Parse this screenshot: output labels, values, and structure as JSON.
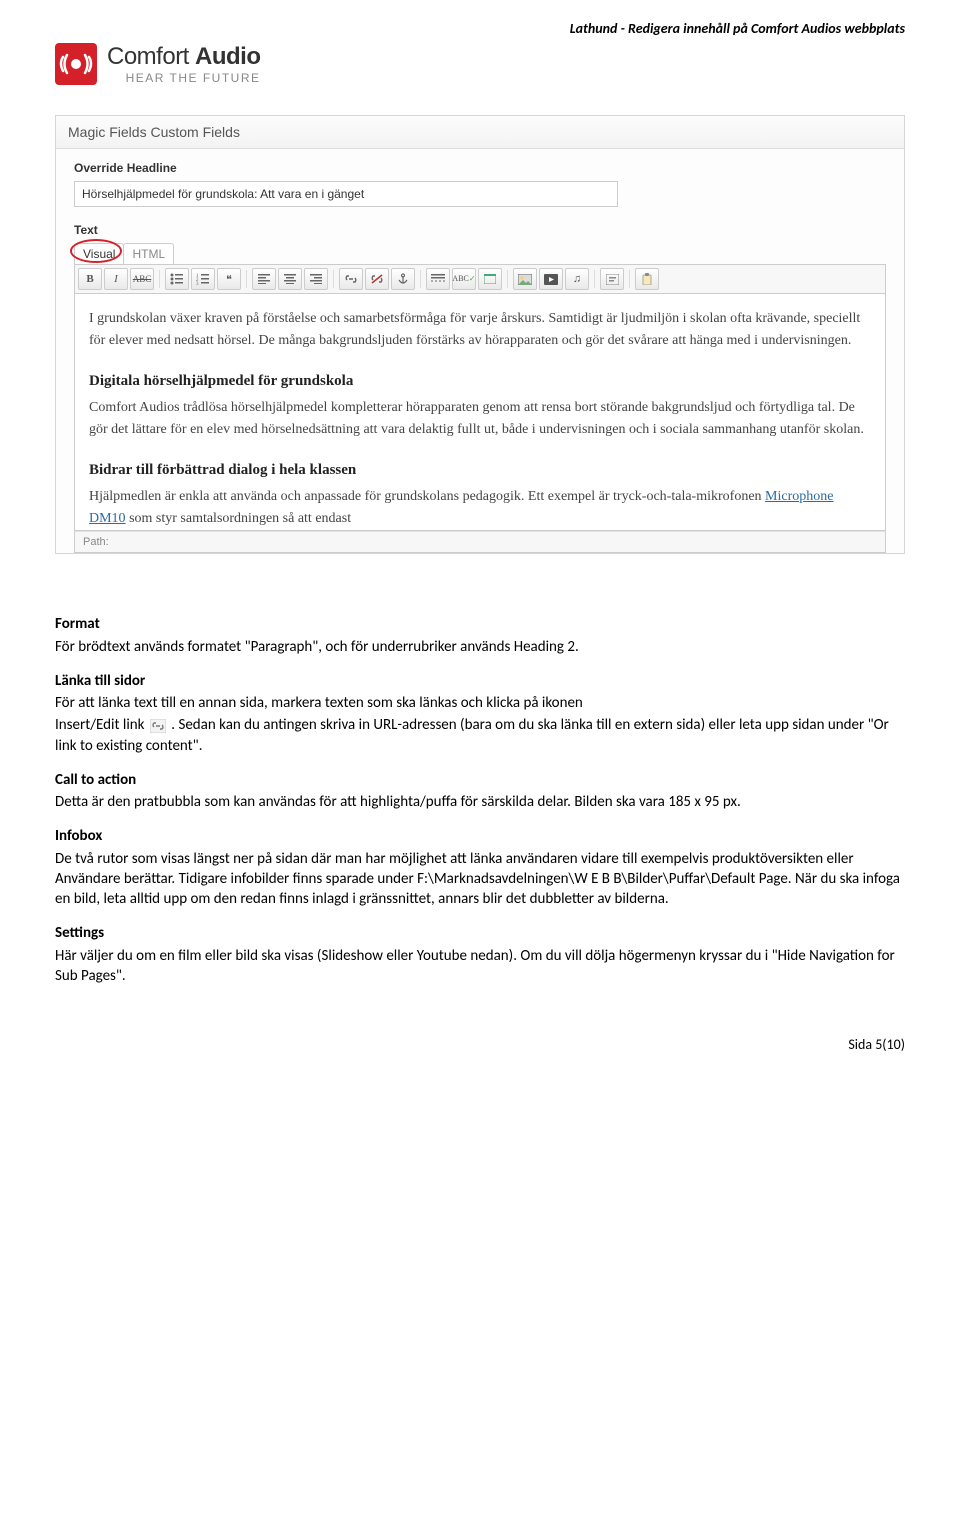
{
  "header": {
    "running_title": "Lathund - Redigera innehåll på Comfort Audios webbplats",
    "brand_a": "Comfort",
    "brand_b": "Audio",
    "tagline": "HEAR THE FUTURE"
  },
  "panel": {
    "title": "Magic Fields Custom Fields",
    "override_label": "Override Headline",
    "override_value": "Hörselhjälpmedel för grundskola: Att vara en i gänget",
    "text_label": "Text",
    "tab_visual": "Visual",
    "tab_html": "HTML",
    "toolbar": {
      "b": "B",
      "i": "I",
      "abc": "ABC",
      "quote": "❝",
      "spell": "ABC",
      "path_label": "Path:"
    },
    "content_p1": "I grundskolan växer kraven på förståelse och samarbetsförmåga för varje årskurs. Samtidigt är ljudmiljön i skolan ofta krävande, speciellt för elever med nedsatt hörsel. De många bakgrundsljuden förstärks av hörapparaten och gör det svårare att hänga med i undervisningen.",
    "content_h1": "Digitala hörselhjälpmedel för grundskola",
    "content_p2": "Comfort Audios trådlösa hörselhjälpmedel kompletterar hörapparaten genom att rensa bort störande bakgrundsljud och förtydliga tal. De gör det lättare för en elev med hörselnedsättning att vara delaktig fullt ut, både i undervisningen och i sociala sammanhang utanför skolan.",
    "content_h2": "Bidrar till förbättrad dialog i hela klassen",
    "content_p3_a": "Hjälpmedlen är enkla att använda och anpassade för grundskolans pedagogik. Ett exempel är tryck-och-tala-mikrofonen ",
    "content_p3_link": "Microphone DM10",
    "content_p3_b": " som styr samtalsordningen så att endast"
  },
  "doc": {
    "format_h": "Format",
    "format_p": "För brödtext används formatet \"Paragraph\", och för underrubriker används Heading 2.",
    "lanka_h": "Länka till sidor",
    "lanka_p1": "För att länka text till en annan sida, markera texten som ska länkas och klicka på ikonen",
    "lanka_p2a": "Insert/Edit link ",
    "lanka_p2b": ". Sedan kan du antingen skriva in URL-adressen (bara om du ska länka till en extern sida) eller leta upp sidan under \"Or link to existing content\".",
    "cta_h": "Call to action",
    "cta_p": "Detta är den pratbubbla som kan användas för att highlighta/puffa för särskilda delar. Bilden ska vara 185 x 95 px.",
    "infobox_h": "Infobox",
    "infobox_p": "De två rutor som visas längst ner på sidan där man har möjlighet att länka användaren vidare till exempelvis produktöversikten eller Användare berättar. Tidigare infobilder finns sparade under F:\\Marknadsavdelningen\\W E B B\\Bilder\\Puffar\\Default Page. När du ska infoga en bild, leta alltid upp om den redan finns inlagd i gränssnittet, annars blir det dubbletter av bilderna.",
    "settings_h": "Settings",
    "settings_p": "Här väljer du om en film eller bild ska visas (Slideshow eller Youtube nedan). Om du vill dölja högermenyn kryssar du i \"Hide Navigation for Sub Pages\"."
  },
  "footer": "Sida 5(10)"
}
